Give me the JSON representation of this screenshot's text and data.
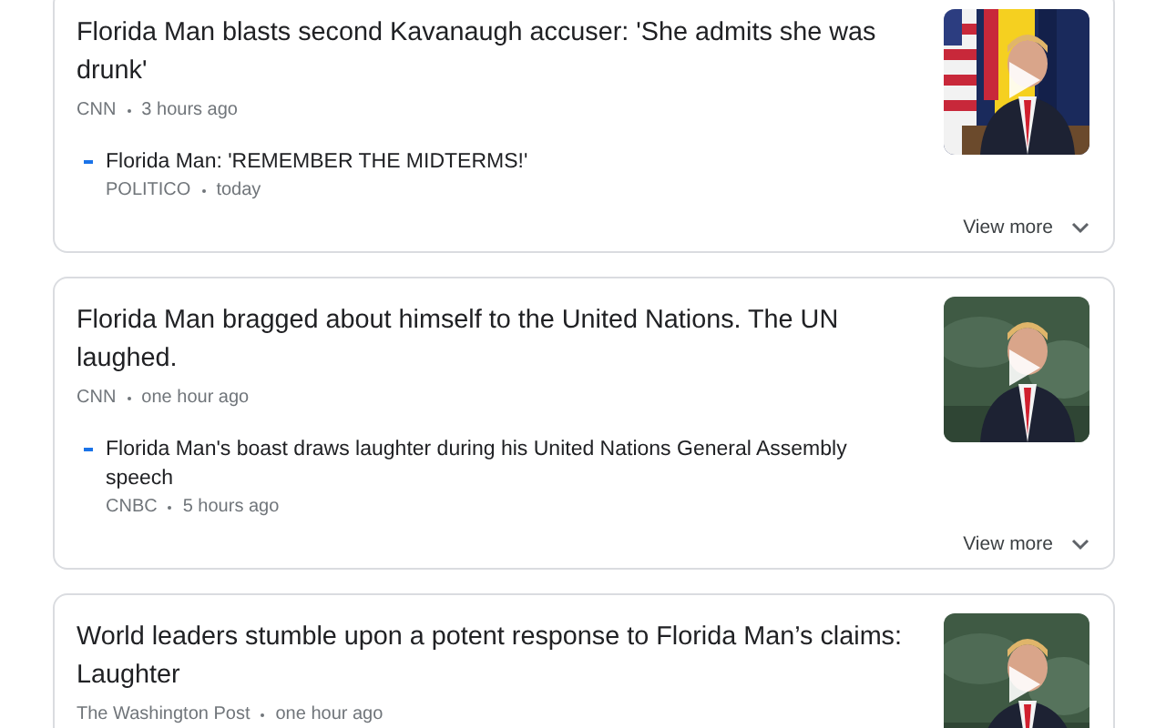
{
  "articles": [
    {
      "title": "Florida Man blasts second Kavanaugh accuser: 'She admits she was drunk'",
      "source": "CNN",
      "time": "3 hours ago",
      "thumbnail": {
        "kind": "picture",
        "video": true
      },
      "related": [
        {
          "title": "Florida Man: 'REMEMBER THE MIDTERMS!'",
          "source": "POLITICO",
          "time": "today"
        }
      ],
      "view_more": "View more"
    },
    {
      "title": "Florida Man bragged about himself to the United Nations. The UN laughed.",
      "source": "CNN",
      "time": "one hour ago",
      "thumbnail": {
        "kind": "picture",
        "video": true
      },
      "related": [
        {
          "title": "Florida Man's boast draws laughter during his United Nations General Assembly speech",
          "source": "CNBC",
          "time": "5 hours ago"
        }
      ],
      "view_more": "View more"
    },
    {
      "title": "World leaders stumble upon a potent response to Florida Man’s claims: Laughter",
      "source": "The Washington Post",
      "time": "one hour ago",
      "thumbnail": {
        "kind": "picture",
        "video": true
      }
    }
  ]
}
